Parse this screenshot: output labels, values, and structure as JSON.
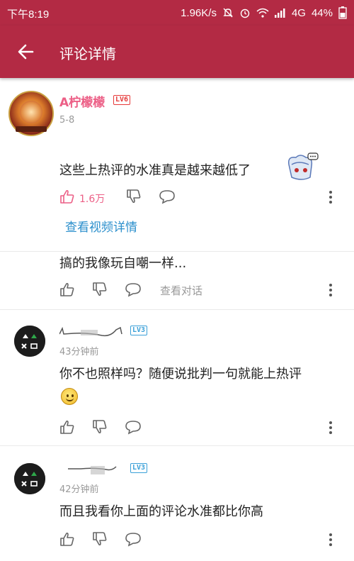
{
  "status_bar": {
    "time": "下午8:19",
    "network_speed": "1.96K/s",
    "network_type": "4G",
    "battery": "44%",
    "icons": [
      "mute-bell-icon",
      "alarm-icon",
      "wifi-icon",
      "signal-icon",
      "battery-icon"
    ]
  },
  "header": {
    "title": "评论详情",
    "back_icon": "arrow-left-icon",
    "background_color": "#b32a44"
  },
  "main_comment": {
    "username": "A柠檬檬",
    "level": "LV6",
    "date": "5-8",
    "text": "这些上热评的水准真是越来越低了",
    "like_count": "1.6万",
    "video_link": "查看视频详情",
    "username_color": "#ec5f86",
    "link_color": "#2b8fcc"
  },
  "replies": [
    {
      "text": "搞的我像玩自嘲一样...",
      "conversation_link": "查看对话"
    },
    {
      "level": "LV3",
      "time": "43分钟前",
      "text": "你不也照样吗？随便说批判一句就能上热评"
    },
    {
      "level": "LV3",
      "time": "42分钟前",
      "text": "而且我看你上面的评论水准都比你高"
    }
  ]
}
